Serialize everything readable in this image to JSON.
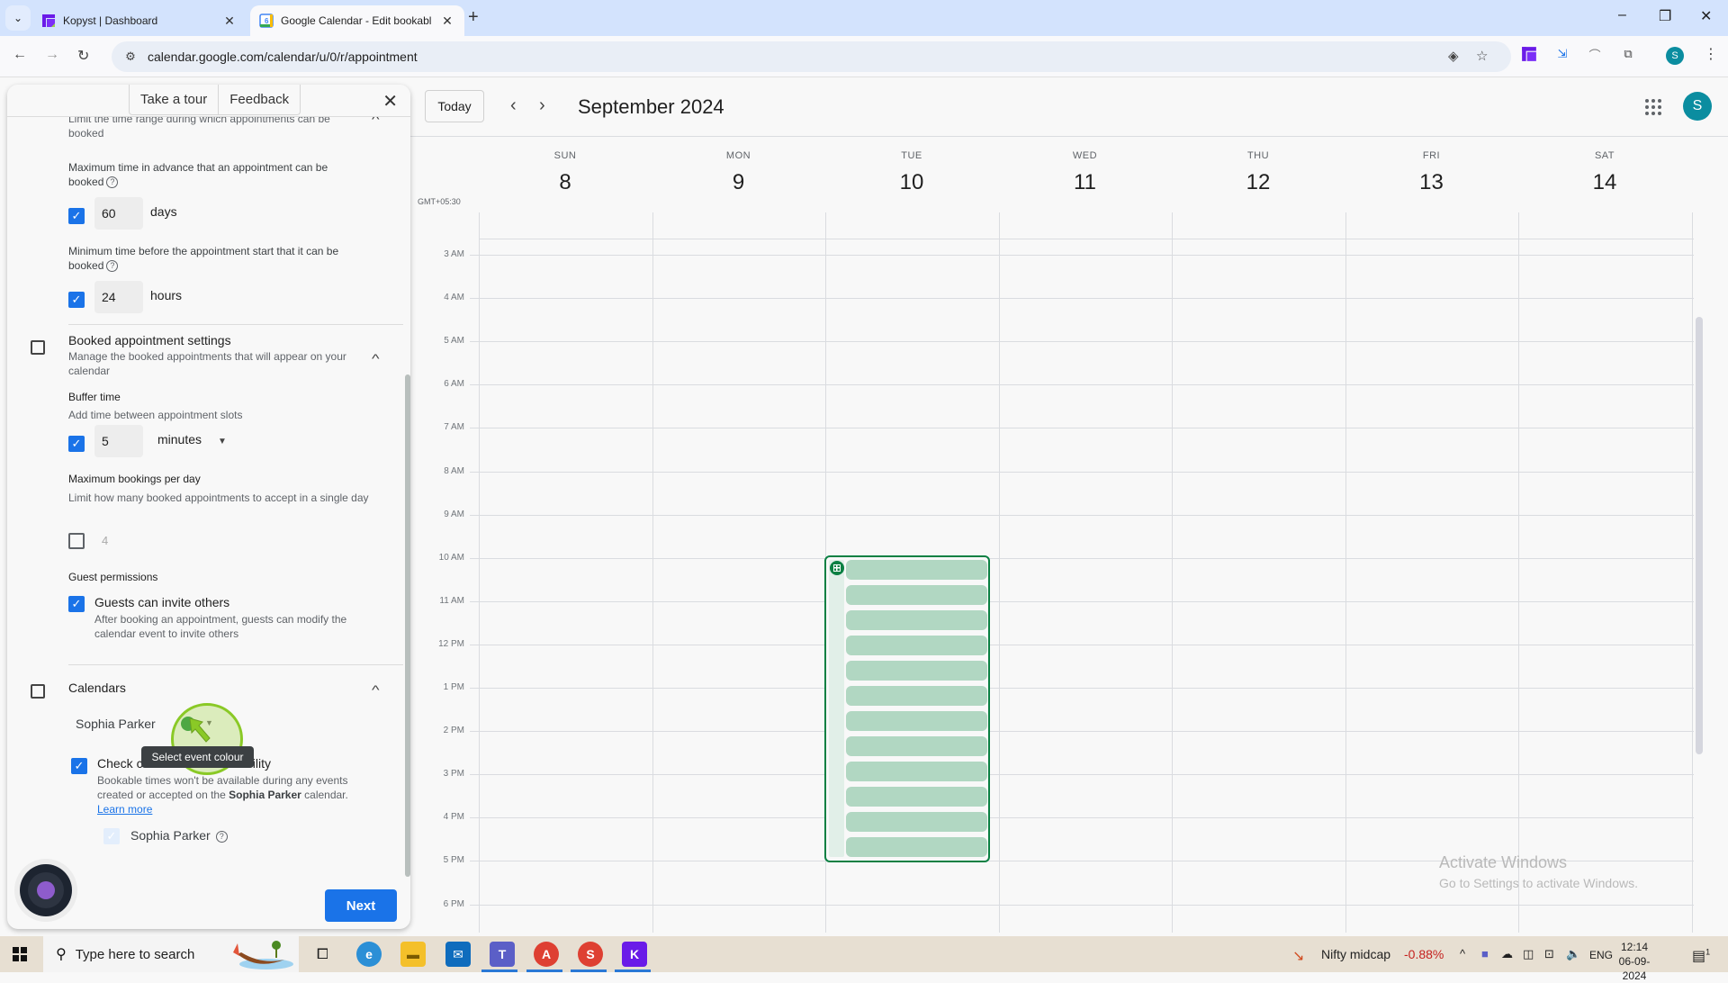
{
  "browser": {
    "tabs": [
      {
        "title": "Kopyst | Dashboard",
        "active": false,
        "favicon": "kopyst-logo-icon"
      },
      {
        "title": "Google Calendar - Edit bookabl",
        "active": true,
        "favicon": "google-calendar-icon",
        "favicon_text": "6"
      }
    ],
    "new_tab_label": "+",
    "url": "calendar.google.com/calendar/u/0/r/appointment",
    "profile_initial": "S",
    "window_controls": {
      "minimize": "–",
      "restore": "❐",
      "close": "✕"
    }
  },
  "panel": {
    "tour_label": "Take a tour",
    "feedback_label": "Feedback",
    "booking_window": {
      "description": "Limit the time range during which appointments can be booked",
      "max_advance": {
        "label": "Maximum time in advance that an appointment can be booked",
        "checked": true,
        "value": "60",
        "unit": "days"
      },
      "min_before": {
        "label": "Minimum time before the appointment start that it can be booked",
        "checked": true,
        "value": "24",
        "unit": "hours"
      }
    },
    "booked_settings": {
      "title": "Booked appointment settings",
      "description": "Manage the booked appointments that will appear on your calendar",
      "buffer": {
        "label": "Buffer time",
        "description": "Add time between appointment slots",
        "checked": true,
        "value": "5",
        "unit": "minutes"
      },
      "max_per_day": {
        "label": "Maximum bookings per day",
        "description": "Limit how many booked appointments to accept in a single day",
        "checked": false,
        "value": "4"
      },
      "guest_permissions": {
        "label": "Guest permissions",
        "option": "Guests can invite others",
        "checked": true,
        "description": "After booking an appointment, guests can modify the calendar event to invite others"
      }
    },
    "calendars": {
      "title": "Calendars",
      "calendar_name": "Sophia Parker",
      "event_color": "#1e8e3e",
      "tooltip": "Select event colour",
      "check_availability": {
        "label": "Check calendars for availability",
        "checked": true,
        "desc_pre": "Bookable times won't be available during any events created or accepted on the ",
        "desc_bold": "Sophia Parker",
        "desc_post": " calendar.",
        "learn_more": "Learn more"
      },
      "sub_calendar": {
        "name": "Sophia Parker",
        "checked": true,
        "disabled": true
      }
    },
    "next_label": "Next"
  },
  "calendar": {
    "today_label": "Today",
    "prev_label": "‹",
    "next_label": "›",
    "month_title": "September 2024",
    "timezone": "GMT+05:30",
    "avatar_initial": "S",
    "days": [
      {
        "name": "SUN",
        "date": "8"
      },
      {
        "name": "MON",
        "date": "9"
      },
      {
        "name": "TUE",
        "date": "10"
      },
      {
        "name": "WED",
        "date": "11"
      },
      {
        "name": "THU",
        "date": "12"
      },
      {
        "name": "FRI",
        "date": "13"
      },
      {
        "name": "SAT",
        "date": "14"
      }
    ],
    "hours": [
      "3 AM",
      "4 AM",
      "5 AM",
      "6 AM",
      "7 AM",
      "8 AM",
      "9 AM",
      "10 AM",
      "11 AM",
      "12 PM",
      "1 PM",
      "2 PM",
      "3 PM",
      "4 PM",
      "5 PM",
      "6 PM"
    ],
    "appointment_block": {
      "day": "TUE",
      "start": "10 AM",
      "end": "5 PM",
      "slot_count": 12,
      "color": "#0b8043",
      "slot_color": "#b1d7c2"
    },
    "watermark": {
      "title": "Activate Windows",
      "subtitle": "Go to Settings to activate Windows."
    }
  },
  "taskbar": {
    "search_placeholder": "Type here to search",
    "stock_name": "Nifty midcap",
    "stock_change": "-0.88%",
    "language": "ENG",
    "time": "12:14",
    "date": "06-09-2024",
    "notifications": "1"
  }
}
